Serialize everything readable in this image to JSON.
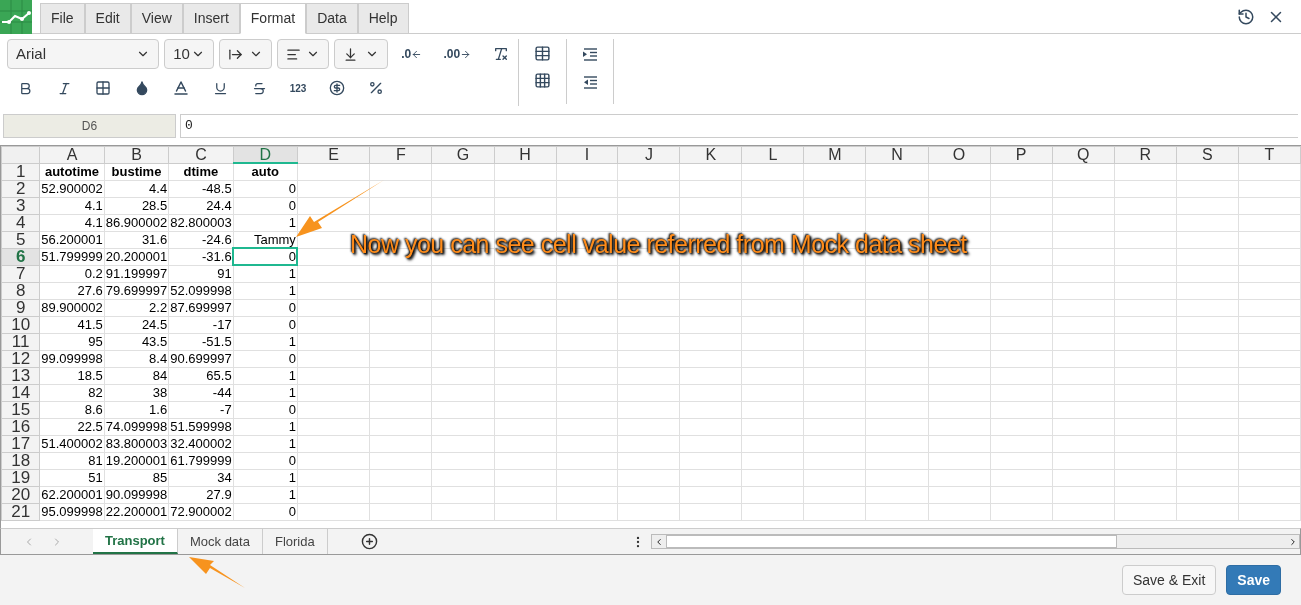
{
  "menu_tabs": [
    {
      "label": "File",
      "selected": false
    },
    {
      "label": "Edit",
      "selected": false
    },
    {
      "label": "View",
      "selected": false
    },
    {
      "label": "Insert",
      "selected": false
    },
    {
      "label": "Format",
      "selected": true
    },
    {
      "label": "Data",
      "selected": false
    },
    {
      "label": "Help",
      "selected": false
    }
  ],
  "toolbar": {
    "font": "Arial",
    "font_size": "10",
    "decimal_labels": [
      ".0",
      ".00"
    ],
    "number_format": "123"
  },
  "formula_bar": {
    "name_box": "D6",
    "value": "0"
  },
  "columns": [
    {
      "label": "A",
      "selected": false
    },
    {
      "label": "B",
      "selected": false
    },
    {
      "label": "C",
      "selected": false
    },
    {
      "label": "D",
      "selected": true
    },
    {
      "label": "E",
      "selected": false
    },
    {
      "label": "F",
      "selected": false
    },
    {
      "label": "G",
      "selected": false
    },
    {
      "label": "H",
      "selected": false
    },
    {
      "label": "I",
      "selected": false
    },
    {
      "label": "J",
      "selected": false
    },
    {
      "label": "K",
      "selected": false
    },
    {
      "label": "L",
      "selected": false
    },
    {
      "label": "M",
      "selected": false
    },
    {
      "label": "N",
      "selected": false
    },
    {
      "label": "O",
      "selected": false
    },
    {
      "label": "P",
      "selected": false
    },
    {
      "label": "Q",
      "selected": false
    },
    {
      "label": "R",
      "selected": false
    },
    {
      "label": "S",
      "selected": false
    },
    {
      "label": "T",
      "selected": false
    }
  ],
  "rows": [
    {
      "number": "1",
      "kind": "header",
      "selected": false,
      "cells": [
        "autotime",
        "bustime",
        "dtime",
        "auto"
      ]
    },
    {
      "number": "2",
      "kind": "data",
      "selected": false,
      "cells": [
        "52.900002",
        "4.4",
        "-48.5",
        "0"
      ]
    },
    {
      "number": "3",
      "kind": "data",
      "selected": false,
      "cells": [
        "4.1",
        "28.5",
        "24.4",
        "0"
      ]
    },
    {
      "number": "4",
      "kind": "data",
      "selected": false,
      "cells": [
        "4.1",
        "86.900002",
        "82.800003",
        "1"
      ]
    },
    {
      "number": "5",
      "kind": "data",
      "selected": false,
      "cells": [
        "56.200001",
        "31.6",
        "-24.6",
        "Tammy"
      ]
    },
    {
      "number": "6",
      "kind": "data",
      "selected": true,
      "cells": [
        "51.799999",
        "20.200001",
        "-31.6",
        "0"
      ]
    },
    {
      "number": "7",
      "kind": "data",
      "selected": false,
      "cells": [
        "0.2",
        "91.199997",
        "91",
        "1"
      ]
    },
    {
      "number": "8",
      "kind": "data",
      "selected": false,
      "cells": [
        "27.6",
        "79.699997",
        "52.099998",
        "1"
      ]
    },
    {
      "number": "9",
      "kind": "data",
      "selected": false,
      "cells": [
        "89.900002",
        "2.2",
        "87.699997",
        "0"
      ]
    },
    {
      "number": "10",
      "kind": "data",
      "selected": false,
      "cells": [
        "41.5",
        "24.5",
        "-17",
        "0"
      ]
    },
    {
      "number": "11",
      "kind": "data",
      "selected": false,
      "cells": [
        "95",
        "43.5",
        "-51.5",
        "1"
      ]
    },
    {
      "number": "12",
      "kind": "data",
      "selected": false,
      "cells": [
        "99.099998",
        "8.4",
        "90.699997",
        "0"
      ]
    },
    {
      "number": "13",
      "kind": "data",
      "selected": false,
      "cells": [
        "18.5",
        "84",
        "65.5",
        "1"
      ]
    },
    {
      "number": "14",
      "kind": "data",
      "selected": false,
      "cells": [
        "82",
        "38",
        "-44",
        "1"
      ]
    },
    {
      "number": "15",
      "kind": "data",
      "selected": false,
      "cells": [
        "8.6",
        "1.6",
        "-7",
        "0"
      ]
    },
    {
      "number": "16",
      "kind": "data",
      "selected": false,
      "cells": [
        "22.5",
        "74.099998",
        "51.599998",
        "1"
      ]
    },
    {
      "number": "17",
      "kind": "data",
      "selected": false,
      "cells": [
        "51.400002",
        "83.800003",
        "32.400002",
        "1"
      ]
    },
    {
      "number": "18",
      "kind": "data",
      "selected": false,
      "cells": [
        "81",
        "19.200001",
        "61.799999",
        "0"
      ]
    },
    {
      "number": "19",
      "kind": "data",
      "selected": false,
      "cells": [
        "51",
        "85",
        "34",
        "1"
      ]
    },
    {
      "number": "20",
      "kind": "data",
      "selected": false,
      "cells": [
        "62.200001",
        "90.099998",
        "27.9",
        "1"
      ]
    },
    {
      "number": "21",
      "kind": "data",
      "selected": false,
      "cells": [
        "95.099998",
        "22.200001",
        "72.900002",
        "0"
      ]
    }
  ],
  "annotation": "Now you can see cell value referred from Mock data sheet",
  "sheet_tabs": [
    {
      "label": "Transport",
      "selected": true
    },
    {
      "label": "Mock data",
      "selected": false
    },
    {
      "label": "Florida",
      "selected": false
    }
  ],
  "buttons": [
    {
      "label": "Save & Exit",
      "kind": "secondary"
    },
    {
      "label": "Save",
      "kind": "primary"
    }
  ]
}
